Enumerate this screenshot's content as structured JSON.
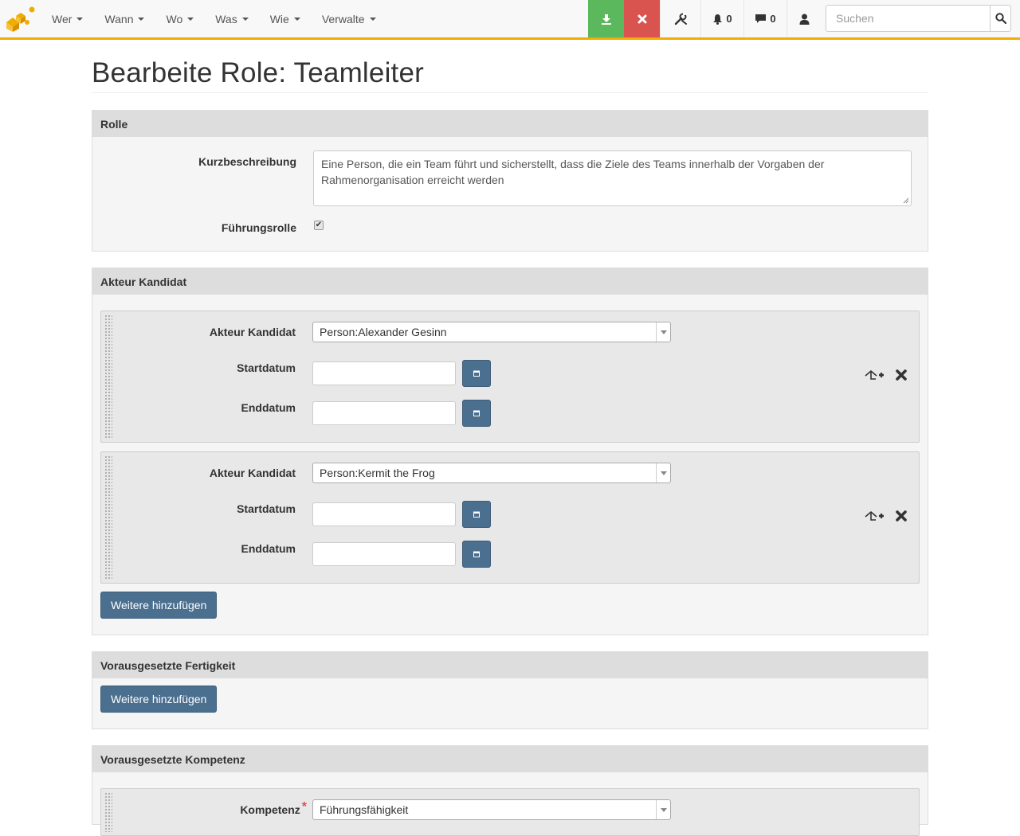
{
  "navbar": {
    "menu": [
      {
        "label": "Wer"
      },
      {
        "label": "Wann"
      },
      {
        "label": "Wo"
      },
      {
        "label": "Was"
      },
      {
        "label": "Wie"
      },
      {
        "label": "Verwalte"
      }
    ],
    "save_icon": "download-icon",
    "cancel_icon": "close-icon",
    "tools_icon": "wrench-icon",
    "notifications": {
      "icon": "bell-icon",
      "count": "0"
    },
    "messages": {
      "icon": "comment-icon",
      "count": "0"
    },
    "user_icon": "user-icon",
    "search": {
      "placeholder": "Suchen",
      "value": "",
      "icon": "search-icon"
    },
    "accent_color": "#f0ad00"
  },
  "page": {
    "title": "Bearbeite Role: Teamleiter"
  },
  "rolle": {
    "heading": "Rolle",
    "kurzbeschreibung_label": "Kurzbeschreibung",
    "kurzbeschreibung_value": "Eine Person, die ein Team führt und sicherstellt, dass die Ziele des Teams innerhalb der Vorgaben der Rahmenorganisation erreicht werden",
    "fuehrungsrolle_label": "Führungsrolle",
    "fuehrungsrolle_checked": true,
    "fuehrungsrolle_check_glyph": "✔"
  },
  "akteur": {
    "heading": "Akteur Kandidat",
    "rows": [
      {
        "kandidat_label": "Akteur Kandidat",
        "kandidat_value": "Person:Alexander Gesinn",
        "start_label": "Startdatum",
        "start_value": "",
        "end_label": "Enddatum",
        "end_value": ""
      },
      {
        "kandidat_label": "Akteur Kandidat",
        "kandidat_value": "Person:Kermit the Frog",
        "start_label": "Startdatum",
        "start_value": "",
        "end_label": "Enddatum",
        "end_value": ""
      }
    ],
    "add_button": "Weitere hinzufügen"
  },
  "fertigkeit": {
    "heading": "Vorausgesetzte Fertigkeit",
    "add_button": "Weitere hinzufügen"
  },
  "kompetenz": {
    "heading": "Vorausgesetzte Kompetenz",
    "label": "Kompetenz",
    "required_mark": "*",
    "value": "Führungsfähigkeit"
  },
  "colors": {
    "save": "#5cb85c",
    "cancel": "#d9534f",
    "primary_button": "#4b6f8f"
  }
}
